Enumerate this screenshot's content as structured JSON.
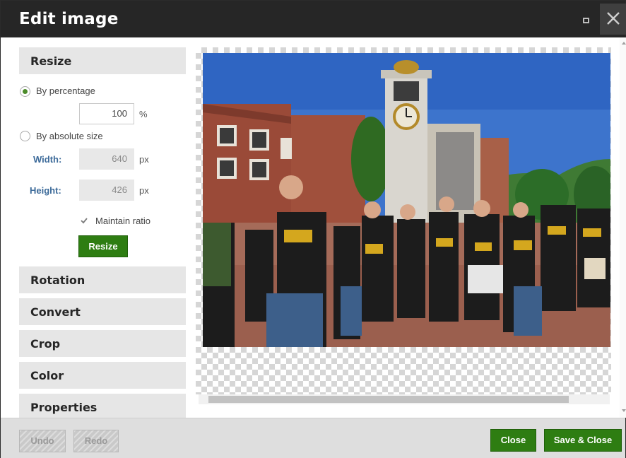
{
  "window": {
    "title": "Edit image"
  },
  "sections": {
    "resize": "Resize",
    "rotation": "Rotation",
    "convert": "Convert",
    "crop": "Crop",
    "color": "Color",
    "properties": "Properties"
  },
  "resize": {
    "by_percentage_label": "By percentage",
    "percentage_value": "100",
    "percentage_unit": "%",
    "by_absolute_label": "By absolute size",
    "width_label": "Width:",
    "width_value": "640",
    "width_unit": "px",
    "height_label": "Height:",
    "height_value": "426",
    "height_unit": "px",
    "maintain_ratio_label": "Maintain ratio",
    "maintain_ratio_checked": true,
    "resize_button": "Resize",
    "selected_mode": "By percentage"
  },
  "footer": {
    "undo": "Undo",
    "redo": "Redo",
    "close": "Close",
    "save_close": "Save & Close"
  },
  "colors": {
    "accent_green": "#2e7d12",
    "title_bar": "#262626",
    "field_label_blue": "#3d6b9a"
  },
  "icons": {
    "maximize": "maximize-icon",
    "close": "close-icon",
    "checkmark": "checkmark-icon",
    "scroll_left": "scroll-left-arrow-icon",
    "scroll_right": "scroll-right-arrow-icon"
  }
}
